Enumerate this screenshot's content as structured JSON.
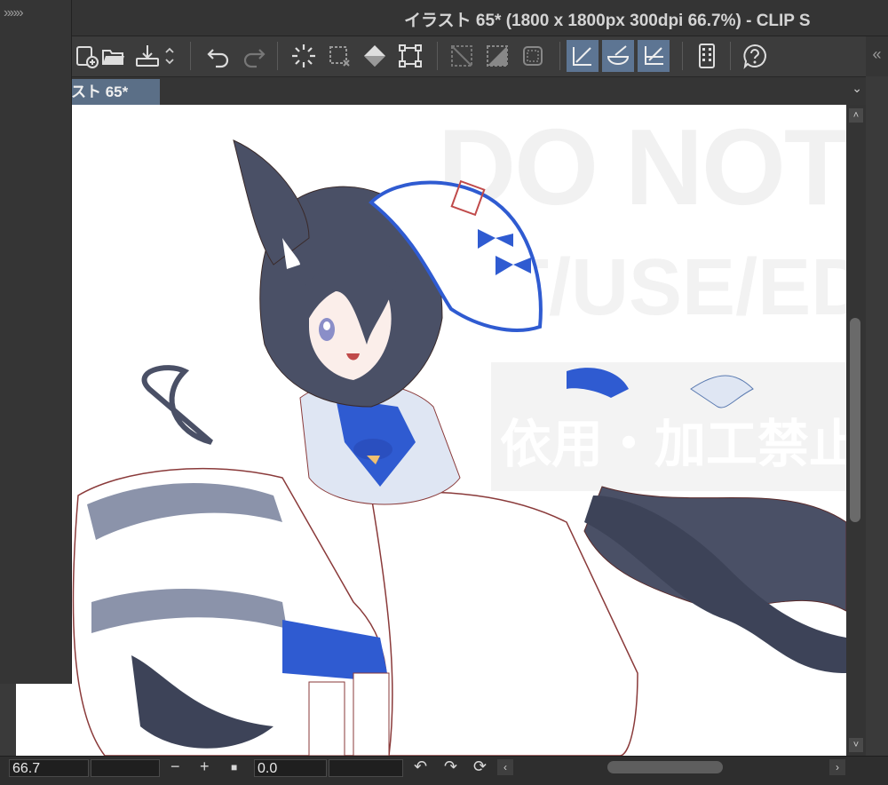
{
  "window": {
    "title": "イラスト 65* (1800 x 1800px 300dpi 66.7%)  - CLIP S"
  },
  "left_panel": {
    "collapse_label": "»»»"
  },
  "toolbar": {
    "buttons": [
      {
        "name": "new-canvas-icon"
      },
      {
        "name": "open-file-icon"
      },
      {
        "name": "save-icon"
      },
      {
        "name": "undo-icon"
      },
      {
        "name": "redo-icon"
      },
      {
        "name": "loading-spinner-icon"
      },
      {
        "name": "deselect-icon"
      },
      {
        "name": "fill-icon"
      },
      {
        "name": "transform-icon"
      },
      {
        "name": "clear-selection-icon"
      },
      {
        "name": "invert-selection-icon"
      },
      {
        "name": "show-selection-icon"
      },
      {
        "name": "snap-ruler-icon",
        "active": true
      },
      {
        "name": "snap-special-ruler-icon",
        "active": true
      },
      {
        "name": "snap-grid-icon",
        "active": true
      },
      {
        "name": "smartphone-icon"
      },
      {
        "name": "help-icon"
      }
    ],
    "right_collapse": "«"
  },
  "tabs": [
    {
      "label": "スト 65*"
    }
  ],
  "canvas": {
    "watermark_line1": "DO NOT",
    "watermark_line2": "ST/USE/EDIT",
    "watermark_line3": "依用・加工禁止"
  },
  "statusbar": {
    "zoom_value": "66.7",
    "rotation_value": "0.0",
    "zoom_out": "−",
    "zoom_in": "+",
    "reset": "■",
    "rotate_left": "↶",
    "rotate_right": "↷",
    "reset_rotation": "⟳",
    "scroll_left": "‹",
    "scroll_right": "›"
  },
  "scroll": {
    "up": "˄",
    "down": "˅"
  }
}
